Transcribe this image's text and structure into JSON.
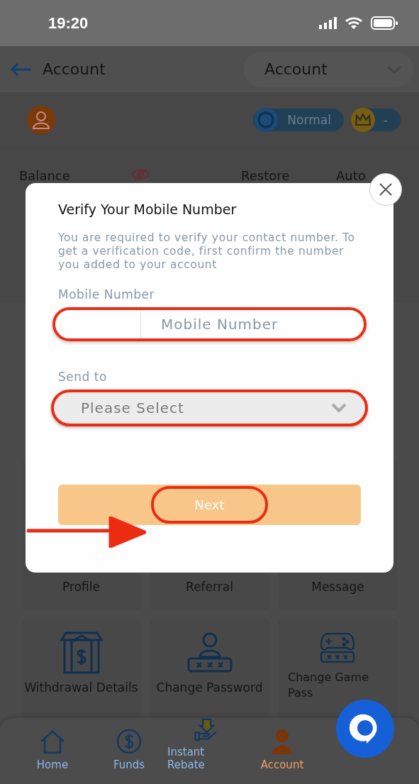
{
  "status_bar": {
    "time": "19:20"
  },
  "header": {
    "title": "Account",
    "dropdown": "Account"
  },
  "profile": {
    "badges": [
      {
        "label": "Normal",
        "kind": "level"
      },
      {
        "label": "-",
        "kind": "vip"
      }
    ]
  },
  "balance_bar": {
    "labels": [
      "Balance",
      "Restore",
      "Auto"
    ]
  },
  "menu_grid": [
    {
      "label": "Profile"
    },
    {
      "label": "Referral"
    },
    {
      "label": "Message"
    },
    {
      "label": "Withdrawal Details"
    },
    {
      "label": "Change Password"
    },
    {
      "label": "Change Game Pass"
    }
  ],
  "dialog": {
    "title": "Verify Your Mobile Number",
    "message": "You are required to verify your contact number. To get a verification code, first confirm the number you added to your account",
    "fields": [
      {
        "kind": "phone",
        "label": "Mobile Number",
        "placeholder": "Mobile Number",
        "highlighted": true
      },
      {
        "kind": "select",
        "label": "Send to",
        "value": "Please Select",
        "highlighted": true
      }
    ],
    "button": {
      "label": "Next",
      "highlighted": true
    }
  },
  "bottom_nav": [
    {
      "label": "Home",
      "selected": false
    },
    {
      "label": "Funds",
      "selected": false
    },
    {
      "label": "Instant Rebate",
      "selected": false
    },
    {
      "label": "Account",
      "selected": true
    }
  ]
}
